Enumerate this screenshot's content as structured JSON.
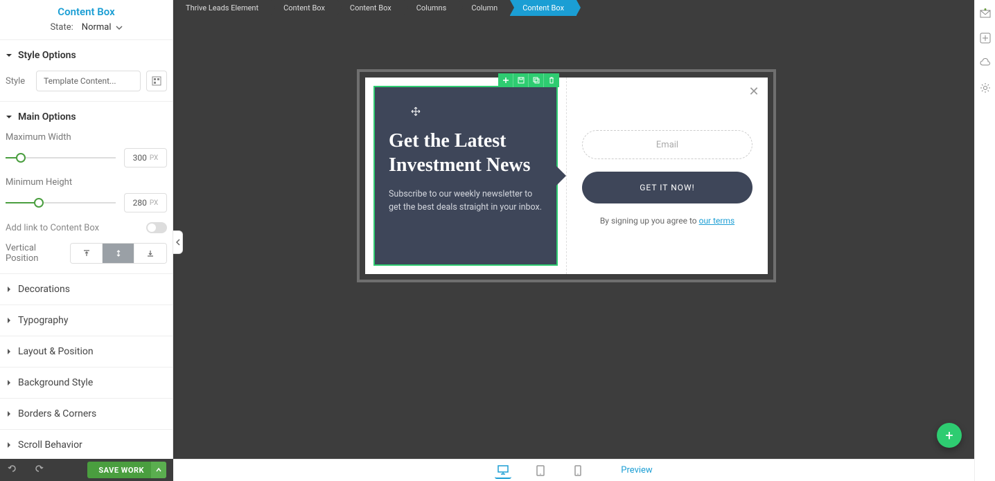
{
  "sidebar": {
    "title": "Content Box",
    "state_label": "State:",
    "state_value": "Normal",
    "sections": {
      "style_options": {
        "title": "Style Options",
        "style_label": "Style",
        "style_value": "Template Content..."
      },
      "main_options": {
        "title": "Main Options",
        "max_width_label": "Maximum Width",
        "max_width_value": "300",
        "max_width_unit": "PX",
        "min_height_label": "Minimum Height",
        "min_height_value": "280",
        "min_height_unit": "PX",
        "add_link_label": "Add link to Content Box",
        "vpos_label": "Vertical Position"
      },
      "decorations": "Decorations",
      "typography": "Typography",
      "layout_position": "Layout & Position",
      "background_style": "Background Style",
      "borders_corners": "Borders & Corners",
      "scroll_behavior": "Scroll Behavior"
    },
    "save_label": "SAVE WORK"
  },
  "breadcrumb": [
    "Thrive Leads Element",
    "Content Box",
    "Content Box",
    "Columns",
    "Column",
    "Content Box"
  ],
  "popup": {
    "heading": "Get the Latest Investment News",
    "subtext": "Subscribe to our weekly newsletter to get the best deals straight in your inbox.",
    "email_placeholder": "Email",
    "cta": "GET IT NOW!",
    "terms_prefix": "By signing up you agree to ",
    "terms_link": "our terms"
  },
  "device_bar": {
    "preview": "Preview"
  }
}
